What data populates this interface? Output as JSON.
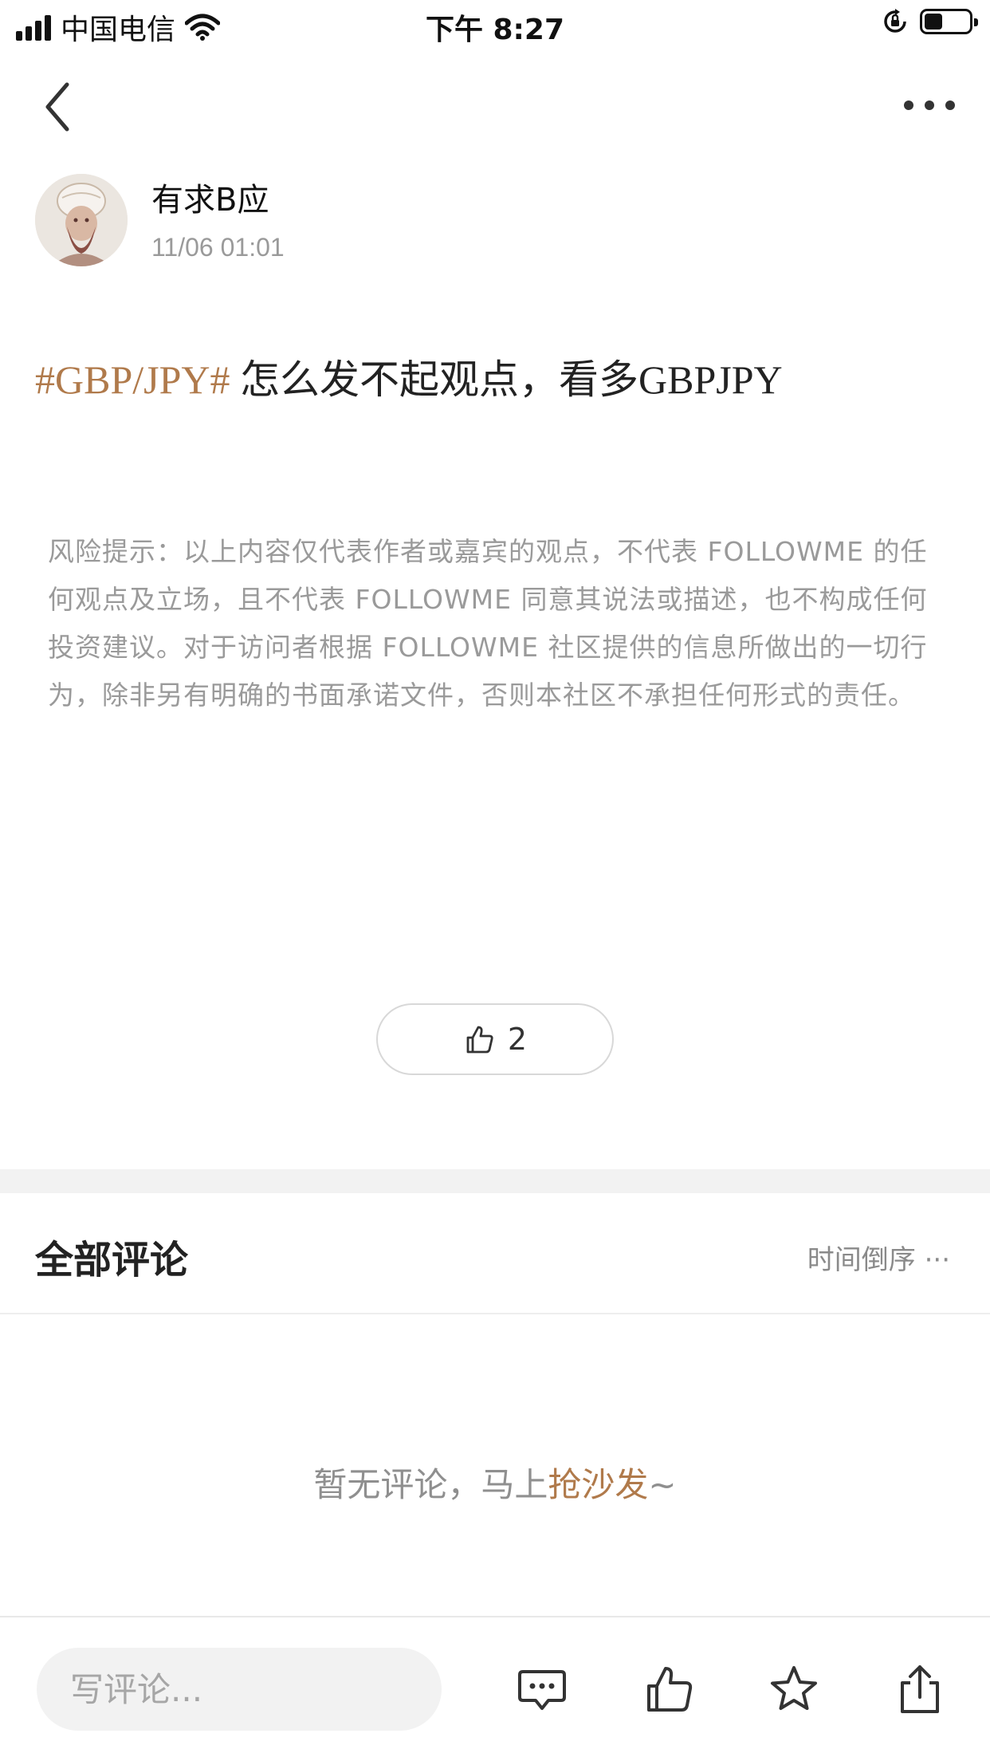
{
  "status_bar": {
    "carrier": "中国电信",
    "time": "下午 8:27",
    "signal_bars": 4,
    "battery_level": 0.4
  },
  "nav": {
    "back_icon": "chevron-left-icon",
    "more_icon": "more-horizontal-icon"
  },
  "author": {
    "name": "有求B应",
    "date": "11/06 01:01"
  },
  "post": {
    "hashtag": "#GBP/JPY#",
    "text": " 怎么发不起观点，看多GBPJPY",
    "disclaimer": "风险提示：以上内容仅代表作者或嘉宾的观点，不代表 FOLLOWME 的任何观点及立场，且不代表 FOLLOWME 同意其说法或描述，也不构成任何投资建议。对于访问者根据 FOLLOWME 社区提供的信息所做出的一切行为，除非另有明确的书面承诺文件，否则本社区不承担任何形式的责任。",
    "like_count": "2"
  },
  "comments": {
    "title": "全部评论",
    "sort_label": "时间倒序 ···",
    "empty_prefix": "暂无评论，马上",
    "empty_action": "抢沙发",
    "empty_suffix": "~"
  },
  "bottom_bar": {
    "input_placeholder": "写评论...",
    "icons": [
      "comment-icon",
      "thumbs-up-icon",
      "star-icon",
      "share-icon"
    ]
  },
  "colors": {
    "accent": "#b07a4b",
    "muted_text": "#9a9a9a",
    "divider": "#f2f2f2"
  }
}
